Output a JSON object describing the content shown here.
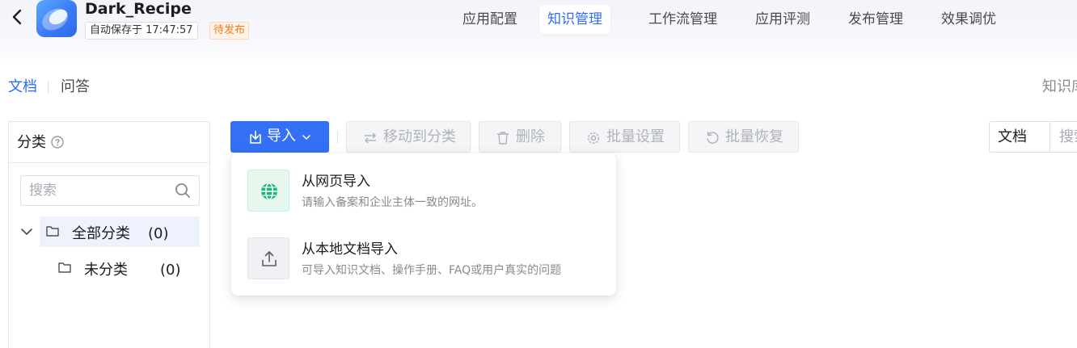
{
  "header": {
    "app_name": "Dark_Recipe",
    "autosave_text": "自动保存于 17:47:57",
    "status_badge": "待发布",
    "tabs": [
      {
        "label": "应用配置"
      },
      {
        "label": "知识管理"
      },
      {
        "label": "工作流管理"
      },
      {
        "label": "应用评测"
      },
      {
        "label": "发布管理"
      },
      {
        "label": "效果调优"
      }
    ],
    "active_tab": "知识管理"
  },
  "subtabs": [
    {
      "label": "文档"
    },
    {
      "label": "问答"
    }
  ],
  "subtab_right_label": "知识库",
  "category_panel": {
    "title": "分类",
    "search_placeholder": "搜索",
    "tree": [
      {
        "label": "全部分类",
        "count": "(0)"
      },
      {
        "label": "未分类",
        "count": "(0)"
      }
    ]
  },
  "toolbar": {
    "import_label": "导入",
    "move_label": "移动到分类",
    "delete_label": "删除",
    "batch_settings_label": "批量设置",
    "batch_restore_label": "批量恢复"
  },
  "right_filter": {
    "selected": "文档",
    "search_placeholder": "搜索"
  },
  "import_menu": {
    "items": [
      {
        "title": "从网页导入",
        "desc": "请输入备案和企业主体一致的网址。",
        "icon": "globe-icon"
      },
      {
        "title": "从本地文档导入",
        "desc": "可导入知识文档、操作手册、FAQ或用户真实的问题",
        "icon": "upload-icon"
      }
    ]
  },
  "colors": {
    "primary": "#3470f5",
    "badge_orange": "#f07b1e",
    "globe_green": "#1fb57c"
  }
}
